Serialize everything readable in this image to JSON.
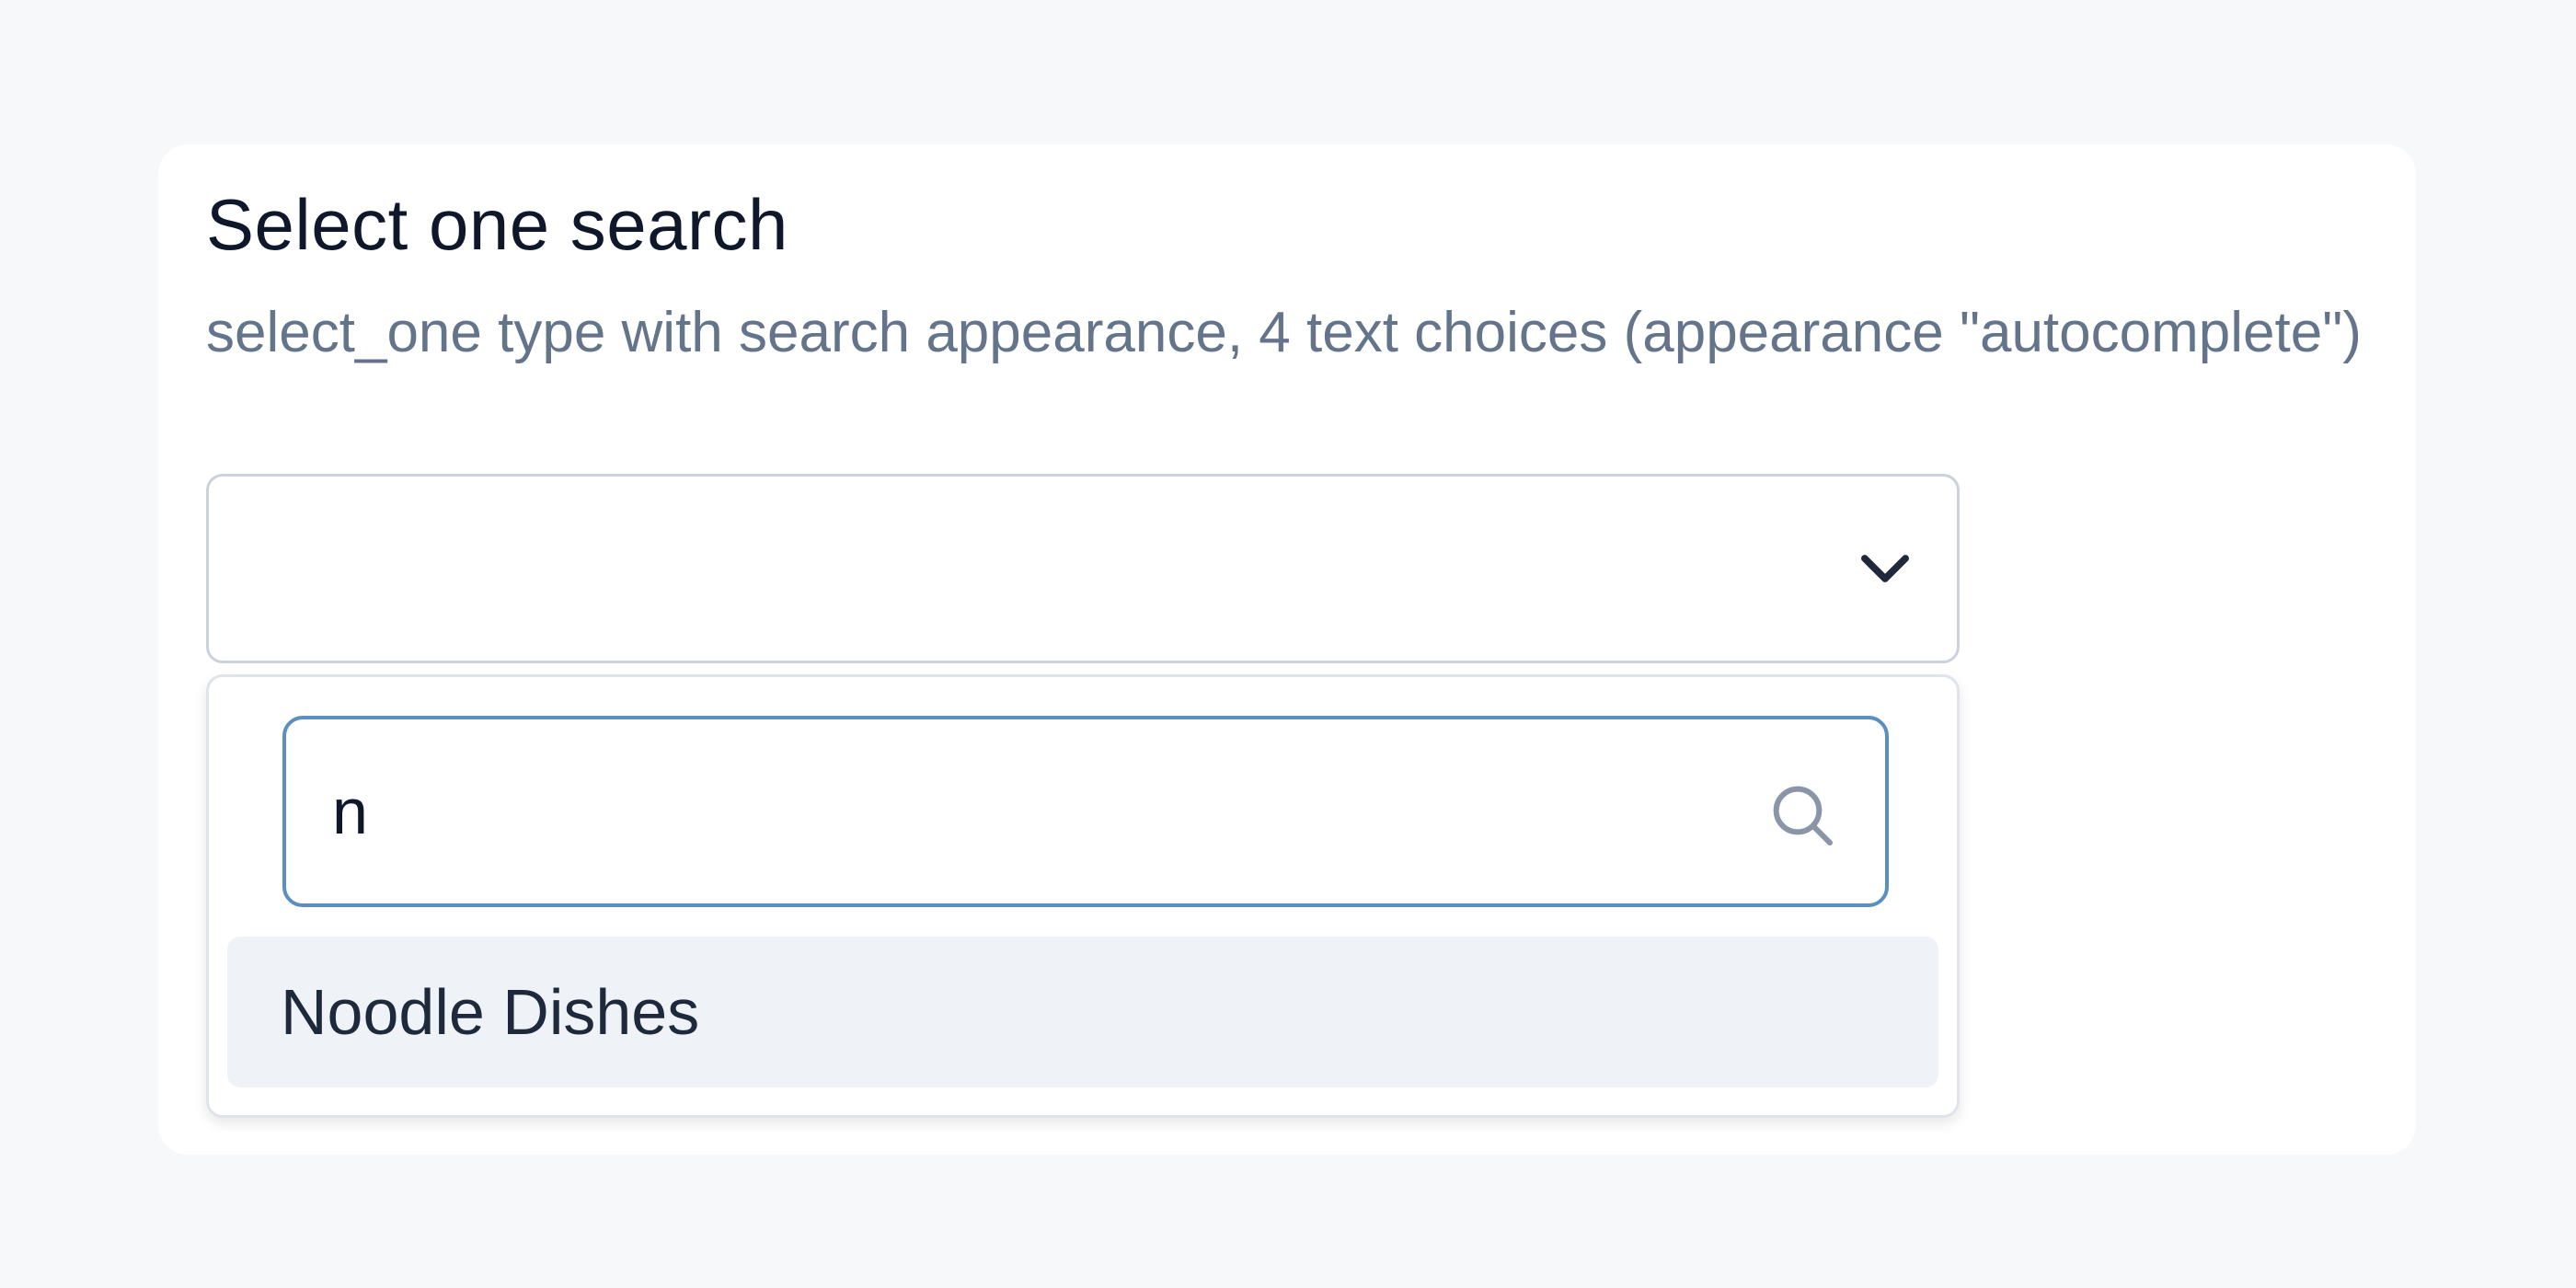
{
  "question": {
    "title": "Select one search",
    "hint": "select_one type with search appearance, 4 text choices (appearance \"autocomplete\")"
  },
  "select": {
    "selected_value": "",
    "chevron_icon": "chevron-down-icon"
  },
  "dropdown": {
    "search": {
      "value": "n",
      "icon": "search-icon"
    },
    "options": [
      {
        "label": "Noodle Dishes"
      }
    ]
  },
  "colors": {
    "background": "#f7f8fa",
    "card": "#ffffff",
    "title_text": "#0f172a",
    "hint_text": "#64748b",
    "search_border_focus": "#5a8fbf",
    "option_highlight": "#eff2f7"
  }
}
